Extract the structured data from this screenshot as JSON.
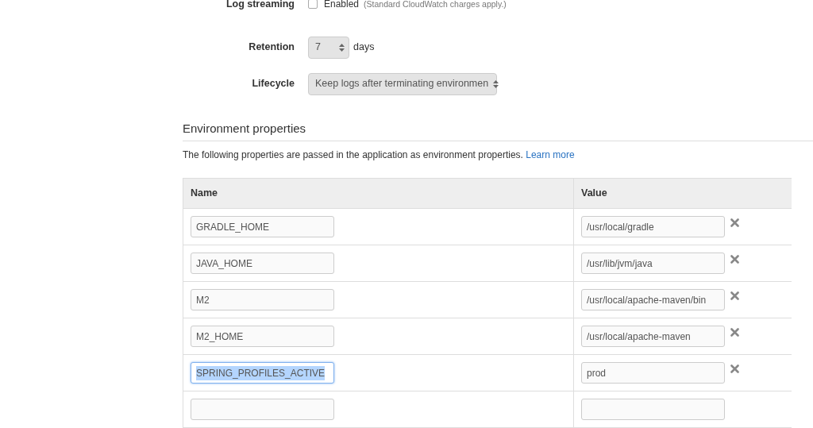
{
  "log_streaming": {
    "label": "Log streaming",
    "checked": false,
    "option": "Enabled",
    "note": "(Standard CloudWatch charges apply.)"
  },
  "retention": {
    "label": "Retention",
    "value": "7",
    "unit": "days"
  },
  "lifecycle": {
    "label": "Lifecycle",
    "value": "Keep logs after terminating environmen"
  },
  "section": {
    "title": "Environment properties",
    "description": "The following properties are passed in the application as environment properties.",
    "link": "Learn more"
  },
  "table": {
    "columns": [
      "Name",
      "Value"
    ],
    "rows": [
      {
        "name": "GRADLE_HOME",
        "value": "/usr/local/gradle",
        "removable": true,
        "focused": false
      },
      {
        "name": "JAVA_HOME",
        "value": "/usr/lib/jvm/java",
        "removable": true,
        "focused": false
      },
      {
        "name": "M2",
        "value": "/usr/local/apache-maven/bin",
        "removable": true,
        "focused": false
      },
      {
        "name": "M2_HOME",
        "value": "/usr/local/apache-maven",
        "removable": true,
        "focused": false
      },
      {
        "name": "SPRING_PROFILES_ACTIVE",
        "value": "prod",
        "removable": true,
        "focused": true
      },
      {
        "name": "",
        "value": "",
        "removable": false,
        "focused": false
      }
    ]
  }
}
